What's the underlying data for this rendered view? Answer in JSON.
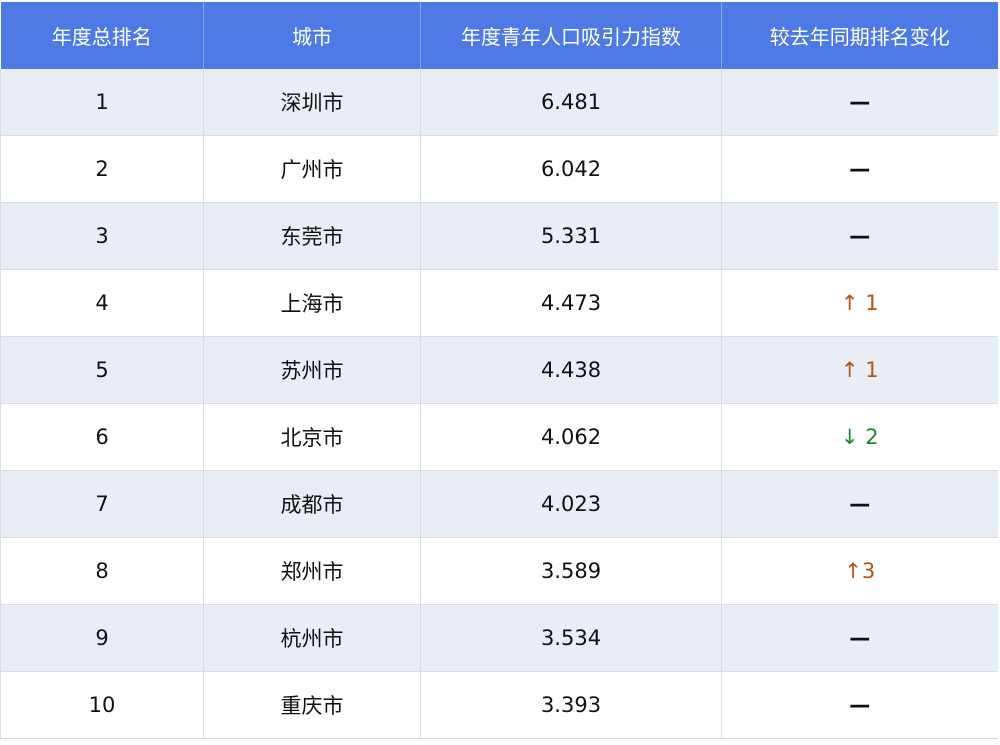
{
  "table": {
    "headers": [
      "年度总排名",
      "城市",
      "年度青年人口吸引力指数",
      "较去年同期排名变化"
    ],
    "rows": [
      {
        "rank": "1",
        "city": "深圳市",
        "index": "6.481",
        "change": "—",
        "trend": "neutral"
      },
      {
        "rank": "2",
        "city": "广州市",
        "index": "6.042",
        "change": "—",
        "trend": "neutral"
      },
      {
        "rank": "3",
        "city": "东莞市",
        "index": "5.331",
        "change": "—",
        "trend": "neutral"
      },
      {
        "rank": "4",
        "city": "上海市",
        "index": "4.473",
        "change": "↑ 1",
        "trend": "up"
      },
      {
        "rank": "5",
        "city": "苏州市",
        "index": "4.438",
        "change": "↑ 1",
        "trend": "up"
      },
      {
        "rank": "6",
        "city": "北京市",
        "index": "4.062",
        "change": "↓ 2",
        "trend": "down"
      },
      {
        "rank": "7",
        "city": "成都市",
        "index": "4.023",
        "change": "—",
        "trend": "neutral"
      },
      {
        "rank": "8",
        "city": "郑州市",
        "index": "3.589",
        "change": "↑3",
        "trend": "up"
      },
      {
        "rank": "9",
        "city": "杭州市",
        "index": "3.534",
        "change": "—",
        "trend": "neutral"
      },
      {
        "rank": "10",
        "city": "重庆市",
        "index": "3.393",
        "change": "—",
        "trend": "neutral"
      }
    ]
  },
  "colors": {
    "header_bg": "#4d7ae5",
    "row_alt_bg": "#e9edf5",
    "up": "#b5530f",
    "down": "#1a8a2c"
  }
}
